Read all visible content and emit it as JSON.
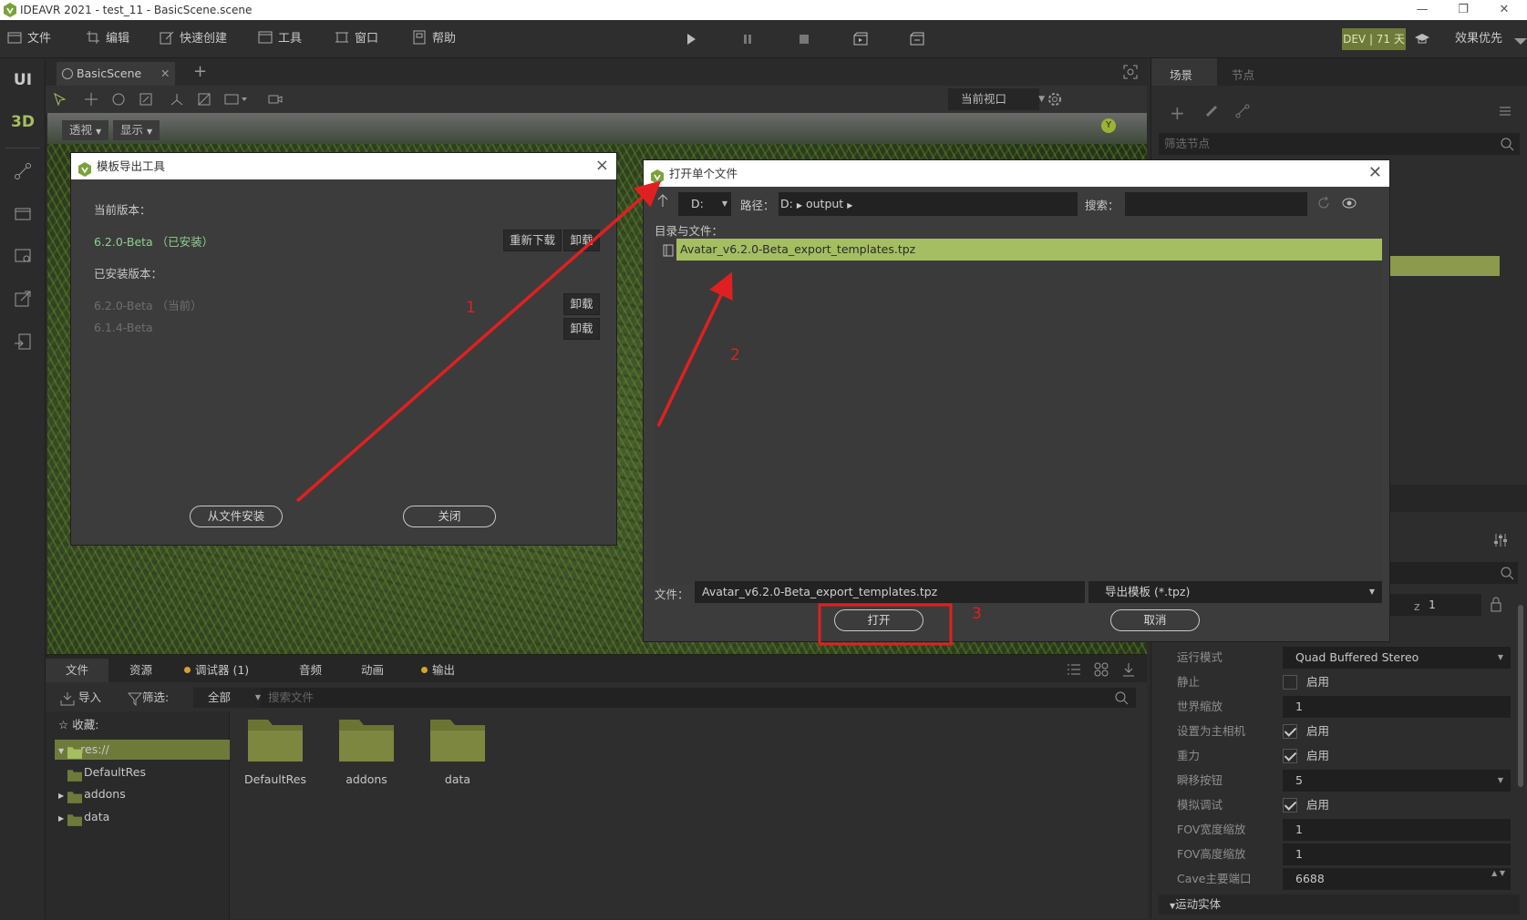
{
  "window": {
    "title": "IDEAVR 2021 - test_11 - BasicScene.scene"
  },
  "menu": {
    "items": [
      "文件",
      "编辑",
      "快速创建",
      "工具",
      "窗口",
      "帮助"
    ],
    "dev_badge": "DEV | 71 天",
    "quality_label": "效果优先"
  },
  "sidebar": {
    "ui_label": "UI",
    "3d_label": "3D"
  },
  "editor": {
    "scene_tab": "BasicScene",
    "view_select": "当前视口",
    "perspective_btn": "透视",
    "display_btn": "显示"
  },
  "dialog_template": {
    "title": "模板导出工具",
    "current_version_label": "当前版本：",
    "current_version": "6.2.0-Beta （已安装）",
    "redownload_label": "重新下载",
    "uninstall_label": "卸载",
    "installed_label": "已安装版本：",
    "installed_versions": [
      {
        "name": "6.2.0-Beta （当前）",
        "action": "卸载"
      },
      {
        "name": "6.1.4-Beta",
        "action": "卸载"
      }
    ],
    "install_from_file": "从文件安装",
    "close": "关闭"
  },
  "dialog_open": {
    "title": "打开单个文件",
    "drive": "D:",
    "path_label": "路径：",
    "path_parts": [
      "D:",
      "output"
    ],
    "search_label": "搜索：",
    "dir_label": "目录与文件：",
    "selected_file": "Avatar_v6.2.0-Beta_export_templates.tpz",
    "file_label": "文件：",
    "file_value": "Avatar_v6.2.0-Beta_export_templates.tpz",
    "filter_value": "导出模板 (*.tpz)",
    "open_label": "打开",
    "cancel_label": "取消"
  },
  "annotations": {
    "n1": "1",
    "n2": "2",
    "n3": "3"
  },
  "right_panel": {
    "tabs": [
      "场景",
      "节点"
    ],
    "filter_placeholder": "筛选节点",
    "z_label": "z",
    "z_value": "1",
    "props": [
      {
        "label": "运行模式",
        "value": "Quad Buffered Stereo",
        "kind": "select"
      },
      {
        "label": "静止",
        "value": "启用",
        "kind": "check",
        "checked": false
      },
      {
        "label": "世界缩放",
        "value": "1",
        "kind": "text"
      },
      {
        "label": "设置为主相机",
        "value": "启用",
        "kind": "check",
        "checked": true
      },
      {
        "label": "重力",
        "value": "启用",
        "kind": "check",
        "checked": true
      },
      {
        "label": "瞬移按钮",
        "value": "5",
        "kind": "select"
      },
      {
        "label": "模拟调试",
        "value": "启用",
        "kind": "check",
        "checked": true
      },
      {
        "label": "FOV宽度缩放",
        "value": "1",
        "kind": "text"
      },
      {
        "label": "FOV高度缩放",
        "value": "1",
        "kind": "text"
      },
      {
        "label": "Cave主要端口",
        "value": "6688",
        "kind": "spin"
      }
    ],
    "section": "运动实体"
  },
  "bottom": {
    "tabs": [
      "文件",
      "资源",
      "调试器 (1)",
      "音频",
      "动画",
      "输出"
    ],
    "import_label": "导入",
    "filter_label": "筛选:",
    "filter_value": "全部",
    "search_placeholder": "搜索文件",
    "favorites_label": "收藏:",
    "tree": [
      "res://",
      "DefaultRes",
      "addons",
      "data"
    ],
    "folders": [
      "DefaultRes",
      "addons",
      "data"
    ]
  },
  "colors": {
    "accent": "#a5be62",
    "badge": "#6e7a3a",
    "annotation": "#e02020"
  }
}
